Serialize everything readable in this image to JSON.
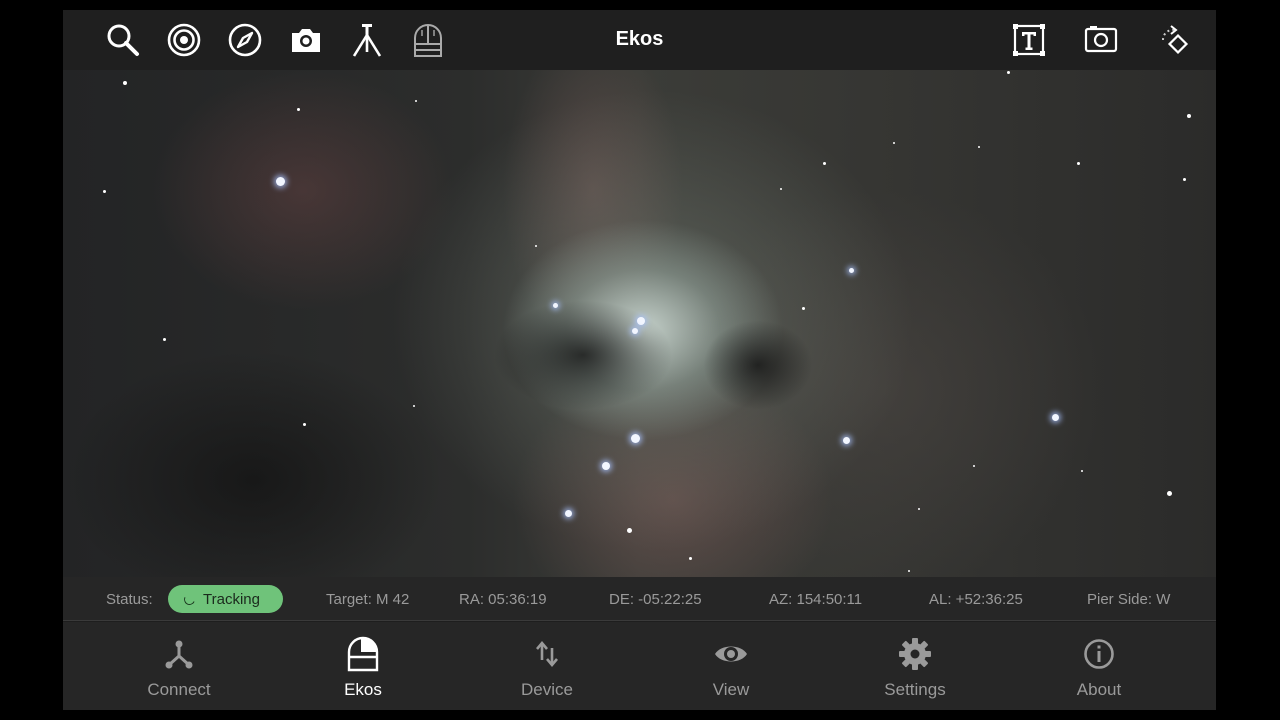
{
  "toolbar": {
    "title": "Ekos",
    "left_icons": [
      "search-icon",
      "target-icon",
      "compass-icon",
      "camera-icon",
      "tripod-icon",
      "observatory-icon"
    ],
    "right_icons": [
      "text-frame-icon",
      "screenshot-icon",
      "rotate-icon"
    ]
  },
  "status": {
    "label": "Status:",
    "state": "Tracking",
    "target": "Target: M 42",
    "ra": "RA: 05:36:19",
    "de": "DE: -05:22:25",
    "az": "AZ: 154:50:11",
    "al": "AL: +52:36:25",
    "pier": "Pier Side: W",
    "state_color": "#6fc37a"
  },
  "nav": {
    "items": [
      {
        "label": "Connect",
        "icon": "connect-icon"
      },
      {
        "label": "Ekos",
        "icon": "dome-icon",
        "active": true
      },
      {
        "label": "Device",
        "icon": "swap-icon"
      },
      {
        "label": "View",
        "icon": "eye-icon"
      },
      {
        "label": "Settings",
        "icon": "gear-icon"
      },
      {
        "label": "About",
        "icon": "info-icon"
      }
    ]
  }
}
